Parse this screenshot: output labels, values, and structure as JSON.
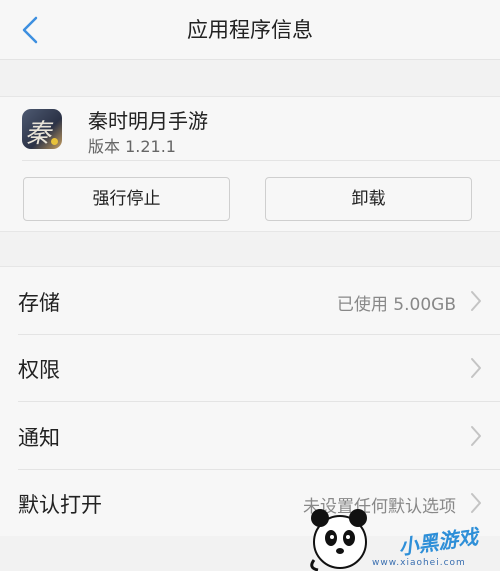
{
  "header": {
    "title": "应用程序信息"
  },
  "app": {
    "name": "秦时明月手游",
    "version": "版本 1.21.1",
    "icon_glyph": "秦"
  },
  "actions": {
    "force_stop_label": "强行停止",
    "uninstall_label": "卸载"
  },
  "settings": [
    {
      "label": "存储",
      "value": "已使用 5.00GB"
    },
    {
      "label": "权限",
      "value": ""
    },
    {
      "label": "通知",
      "value": ""
    },
    {
      "label": "默认打开",
      "value": "未设置任何默认选项"
    }
  ],
  "watermark": {
    "text": "小黑游戏",
    "url": "www.xiaohei.com"
  },
  "colors": {
    "accent": "#3d8fe0",
    "background": "#f2f2f2",
    "card": "#f7f7f7",
    "secondary_text": "#888888"
  }
}
